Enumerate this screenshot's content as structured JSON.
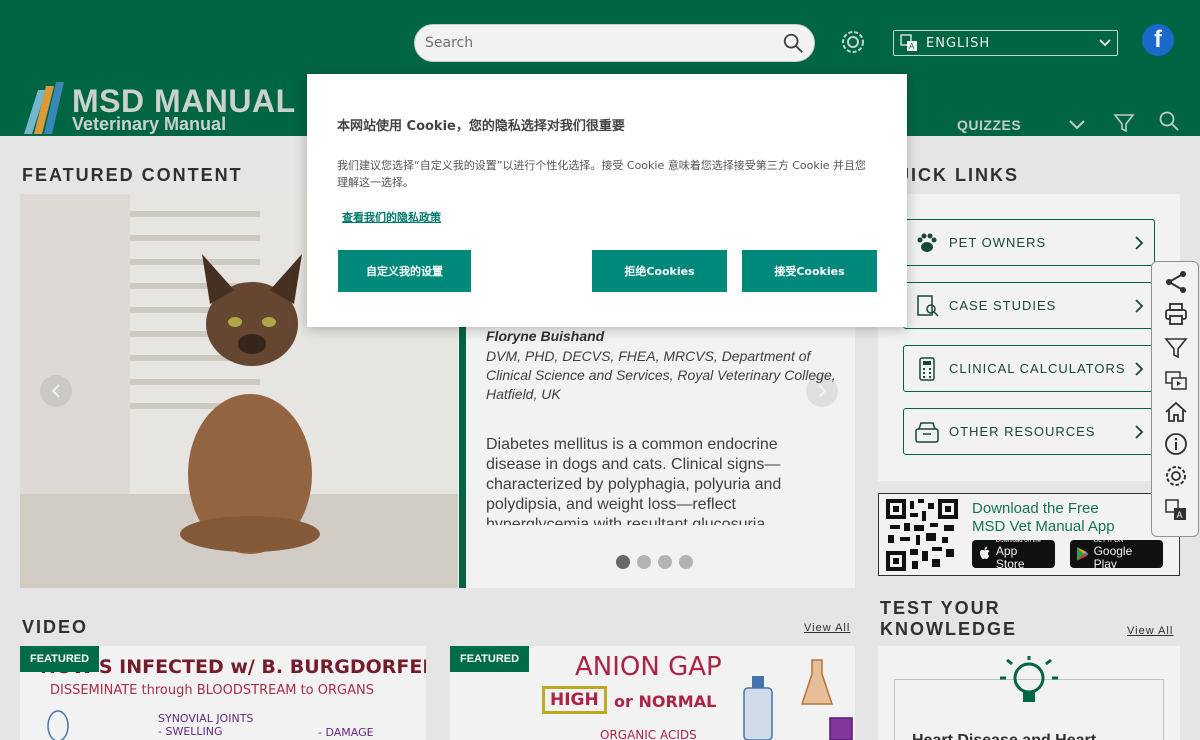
{
  "header": {
    "search_placeholder": "Search",
    "language": "ENGLISH",
    "facebook_glyph": "f",
    "logo_title": "MSD MANUAL",
    "logo_subtitle": "Veterinary Manual",
    "nav_quizzes": "QUIZZES"
  },
  "featured": {
    "section_title": "FEATURED CONTENT",
    "author_name": "Floryne Buishand",
    "author_credentials": "DVM, PHD, DECVS, FHEA, MRCVS, Department of Clinical Science and Services, Royal Veterinary College, Hatfield, UK",
    "summary": "Diabetes mellitus is a common endocrine disease in dogs and cats. Clinical signs—characterized by polyphagia, polyuria and polydipsia, and weight loss—reflect hyperglycemia with resultant glucosuria.",
    "slide_count": 4,
    "active_slide": 1
  },
  "quick_links": {
    "section_title": "QUICK LINKS",
    "items": [
      {
        "label": "PET OWNERS",
        "icon": "paw-icon"
      },
      {
        "label": "CASE STUDIES",
        "icon": "case-studies-icon"
      },
      {
        "label": "CLINICAL CALCULATORS",
        "icon": "calculator-icon"
      },
      {
        "label": "OTHER RESOURCES",
        "icon": "resources-icon"
      }
    ]
  },
  "app_banner": {
    "title_line1": "Download the Free",
    "title_line2": "MSD Vet Manual App",
    "appstore_small": "Download on the",
    "appstore_big": "App Store",
    "googleplay_small": "GET IT ON",
    "googleplay_big": "Google Play"
  },
  "side_toolbar": {
    "icons": [
      "share-icon",
      "print-icon",
      "filter-icon",
      "media-icon",
      "home-icon",
      "info-icon",
      "settings-icon",
      "translate-icon"
    ]
  },
  "video": {
    "section_title": "VIDEO",
    "view_all": "View All",
    "cards": [
      {
        "badge": "FEATURED",
        "line1": "HOW'S INFECTED w/ B. BURGDORFERI",
        "line2": "DISSEMINATE through BLOODSTREAM to ORGANS",
        "line3": "SYNOVIAL JOINTS",
        "line4": "- SWELLING",
        "line5": "- DAMAGE"
      },
      {
        "badge": "FEATURED",
        "line1": "ANION GAP",
        "line2": "HIGH",
        "line3": "or NORMAL",
        "line4": "ORGANIC ACIDS"
      }
    ]
  },
  "test_knowledge": {
    "section_title_line1": "TEST YOUR",
    "section_title_line2": "KNOWLEDGE",
    "view_all": "View All",
    "card_title": "Heart Disease and Heart"
  },
  "cookie": {
    "title": "本网站使用 Cookie，您的隐私选择对我们很重要",
    "body": "我们建议您选择“自定义我的设置”以进行个性化选择。接受 Cookie 意味着您选择接受第三方 Cookie 并且您理解这一选择。",
    "policy_link": "查看我们的隐私政策",
    "customize_button": "自定义我的设置",
    "reject_button": "拒绝Cookies",
    "accept_button": "接受Cookies"
  },
  "colors": {
    "brand_green": "#006b47",
    "cookie_button": "#00897b",
    "app_text": "#1a7a55"
  }
}
